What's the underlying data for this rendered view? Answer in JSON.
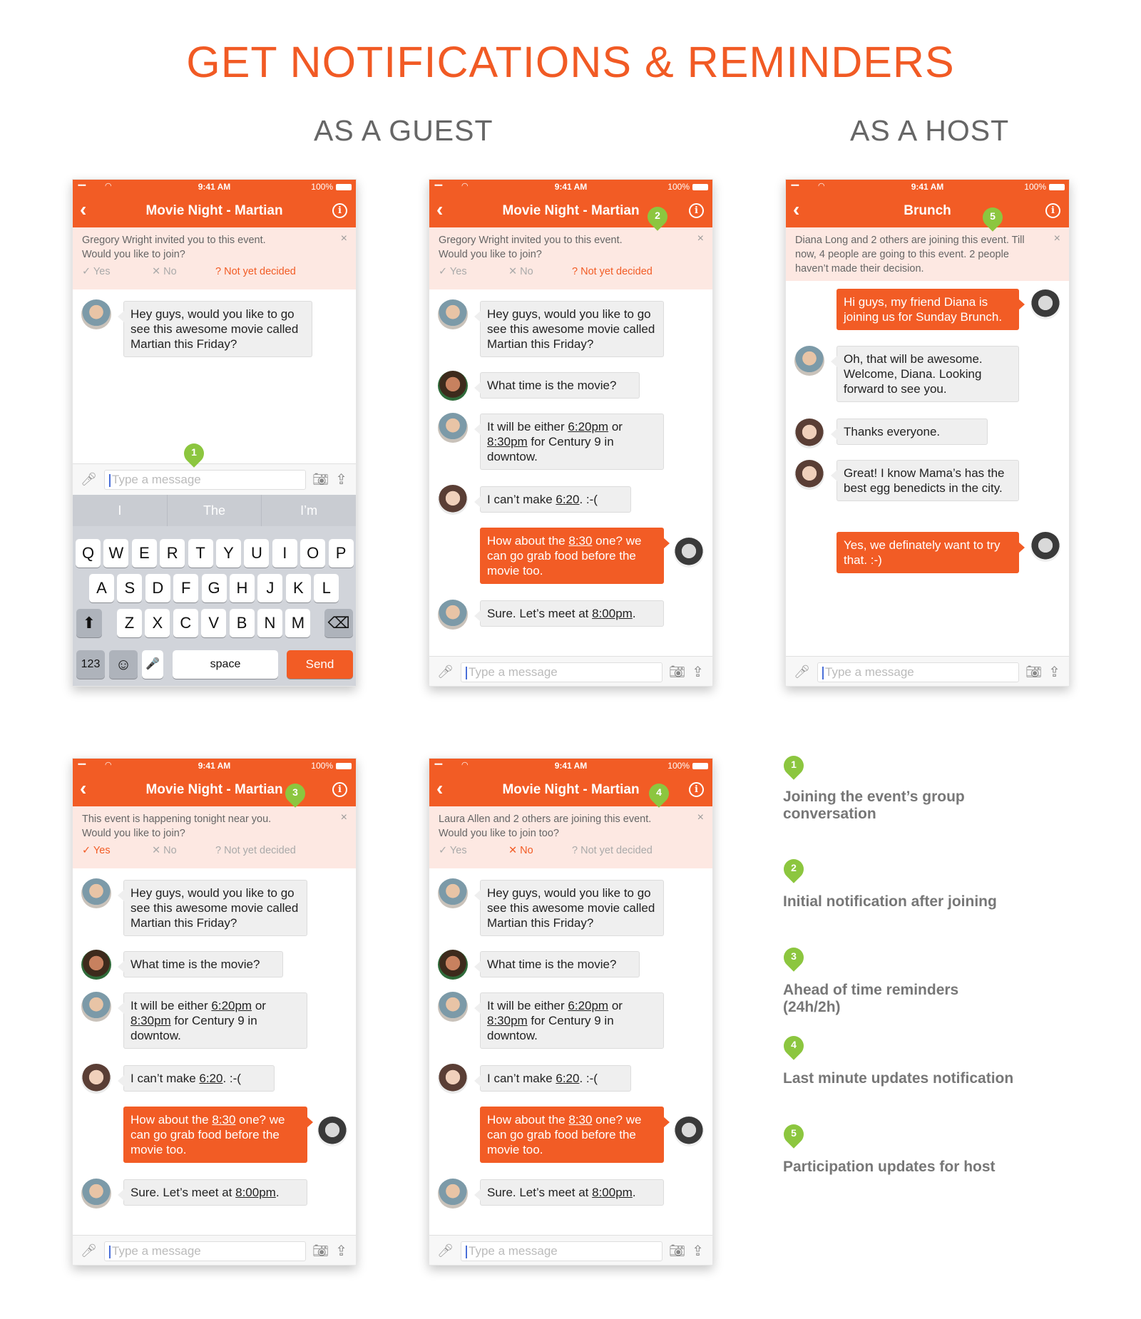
{
  "page": {
    "title": "GET NOTIFICATIONS & REMINDERS",
    "guest_heading": "AS A GUEST",
    "host_heading": "AS A HOST"
  },
  "colors": {
    "brand": "#f25c25",
    "marker": "#8cc63f",
    "notif_bg": "#fde8e2"
  },
  "status": {
    "signal": "•••••",
    "time": "9:41 AM",
    "battery": "100%"
  },
  "common": {
    "movie_title": "Movie Night - Martian",
    "brunch_title": "Brunch",
    "back_icon": "‹",
    "info_icon": "i",
    "close_icon": "×",
    "placeholder": "Type a message",
    "rsvp_yes": "✓ Yes",
    "rsvp_no": "✕ No",
    "rsvp_undecided": "? Not yet decided",
    "msg_intro": "Hey guys, would you like to go see this awesome movie called Martian this Friday?",
    "msg_time": "What time is the movie?",
    "msg_either_a": "It will be either ",
    "msg_either_t1": "6:20pm",
    "msg_either_b": " or ",
    "msg_either_t2": "8:30pm",
    "msg_either_c": " for Century 9 in downtow.",
    "msg_cant_a": "I can’t make ",
    "msg_cant_t": "6:20",
    "msg_cant_b": ". :-(",
    "msg_how_a": "How about the ",
    "msg_how_t": "8:30",
    "msg_how_b": " one? we can go grab food before the movie too.",
    "msg_sure_a": "Sure. Let’s meet at ",
    "msg_sure_t": "8:00pm",
    "msg_sure_b": "."
  },
  "phone1": {
    "notif_line1": "Gregory Wright invited you to this event.",
    "notif_line2": "Would you like to join?",
    "suggestions": [
      "I",
      "The",
      "I’m"
    ],
    "row1": [
      "Q",
      "W",
      "E",
      "R",
      "T",
      "Y",
      "U",
      "I",
      "O",
      "P"
    ],
    "row2": [
      "A",
      "S",
      "D",
      "F",
      "G",
      "H",
      "J",
      "K",
      "L"
    ],
    "row3": [
      "Z",
      "X",
      "C",
      "V",
      "B",
      "N",
      "M"
    ],
    "key_shift": "⬆",
    "key_delete": "⌫",
    "key_123": "123",
    "key_emoji": "☺",
    "key_mic": "🎤",
    "key_space": "space",
    "key_send": "Send"
  },
  "phone2": {
    "notif_line1": "Gregory Wright invited you to this event.",
    "notif_line2": "Would you like to join?"
  },
  "phone3": {
    "notif_text": "Diana Long and 2 others are joining this event. Till now, 4 people are going to this event. 2 people haven’t made their decision.",
    "msg1": "Hi guys, my friend Diana is joining us for Sunday Brunch.",
    "msg2": "Oh, that will be awesome. Welcome, Diana. Looking forward to see you.",
    "msg3": "Thanks everyone.",
    "msg4": "Great! I know Mama’s has the best egg benedicts in the city.",
    "msg5": "Yes, we definately want to try that. :-)"
  },
  "phone4": {
    "notif_line1": "This event is happening tonight near you.",
    "notif_line2": "Would you like to join?"
  },
  "phone5": {
    "notif_line1": "Laura Allen and 2 others are joining this event.",
    "notif_line2": "Would you like to join too?"
  },
  "legend": [
    {
      "num": "1",
      "label": "Joining the event’s group conversation"
    },
    {
      "num": "2",
      "label": "Initial notification after joining"
    },
    {
      "num": "3",
      "label": "Ahead of time reminders (24h/2h)"
    },
    {
      "num": "4",
      "label": "Last minute updates notification"
    },
    {
      "num": "5",
      "label": "Participation updates for host"
    }
  ]
}
